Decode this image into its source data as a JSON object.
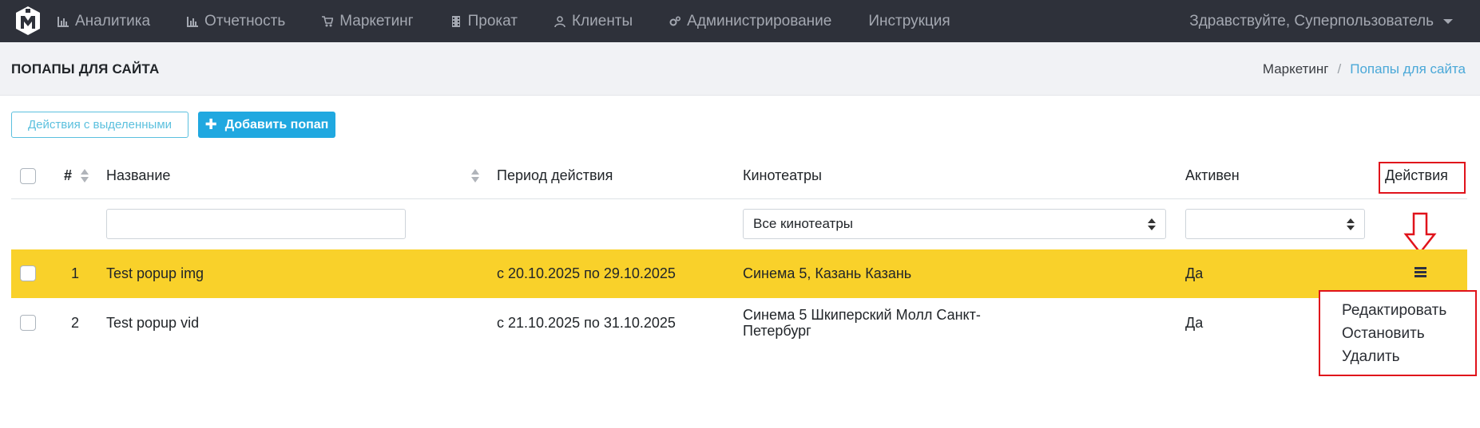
{
  "nav": {
    "items": [
      {
        "label": "Аналитика",
        "icon": "bar-chart-icon"
      },
      {
        "label": "Отчетность",
        "icon": "bar-chart-icon"
      },
      {
        "label": "Маркетинг",
        "icon": "cart-icon"
      },
      {
        "label": "Прокат",
        "icon": "film-icon"
      },
      {
        "label": "Клиенты",
        "icon": "user-icon"
      },
      {
        "label": "Администрирование",
        "icon": "gears-icon"
      },
      {
        "label": "Инструкция",
        "icon": ""
      }
    ],
    "user_greeting": "Здравствуйте, Суперпользователь"
  },
  "page": {
    "title": "ПОПАПЫ ДЛЯ САЙТА",
    "breadcrumb": {
      "parent": "Маркетинг",
      "separator": "/",
      "current": "Попапы для сайта"
    }
  },
  "toolbar": {
    "bulk_actions_label": "Действия с выделенными",
    "add_label": "Добавить попап"
  },
  "table": {
    "headers": {
      "num": "#",
      "name": "Название",
      "period": "Период действия",
      "cinemas": "Кинотеатры",
      "active": "Активен",
      "actions": "Действия"
    },
    "filters": {
      "name_value": "",
      "cinemas_selected": "Все кинотеатры",
      "active_selected": ""
    },
    "rows": [
      {
        "num": "1",
        "name": "Test popup img",
        "period": "с 20.10.2025 по 29.10.2025",
        "cinemas": "Синема 5, Казань Казань",
        "active": "Да"
      },
      {
        "num": "2",
        "name": "Test popup vid",
        "period": "с 21.10.2025 по 31.10.2025",
        "cinemas_line1": "Синема 5 Шкиперский Молл Санкт-",
        "cinemas_line2": "Петербург",
        "active": "Да"
      }
    ]
  },
  "actions_menu": {
    "items": [
      "Редактировать",
      "Остановить",
      "Удалить"
    ]
  },
  "colors": {
    "navbar": "#2e313a",
    "highlight_row": "#f9d12a",
    "primary_button": "#20a8e0",
    "annotation_red": "#e0131b"
  }
}
